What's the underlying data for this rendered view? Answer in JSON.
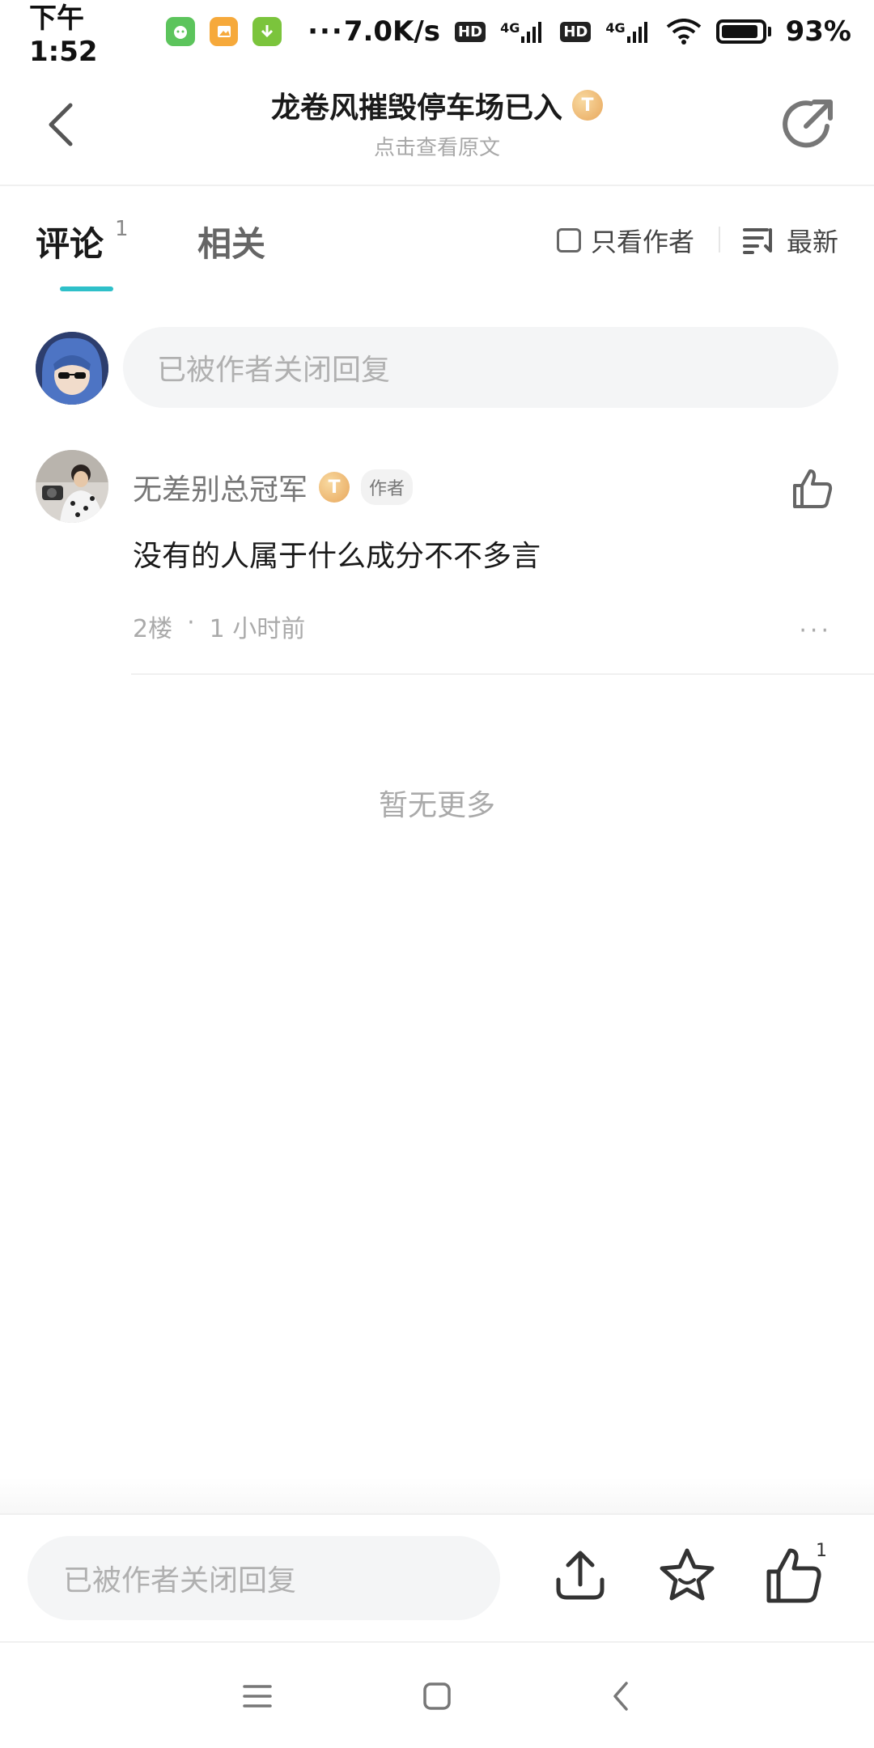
{
  "status_bar": {
    "time": "下午1:52",
    "more": "···",
    "speed": "7.0K/s",
    "hd1": "HD",
    "net1": "4G",
    "hd2": "HD",
    "net2": "4G",
    "battery": "93%",
    "battery_level": 0.93
  },
  "header": {
    "title": "龙卷风摧毁停车场已入",
    "level_badge": "T",
    "subtitle": "点击查看原文"
  },
  "tabs": {
    "comment_label": "评论",
    "comment_count": "1",
    "related_label": "相关",
    "author_only_label": "只看作者",
    "sort_label": "最新"
  },
  "reply_box": {
    "placeholder": "已被作者关闭回复"
  },
  "comment": {
    "username": "无差别总冠军",
    "level_badge": "T",
    "author_tag": "作者",
    "content": "没有的人属于什么成分不不多言",
    "floor": "2楼",
    "separator": "·",
    "time": "1 小时前",
    "more": "···"
  },
  "end_text": "暂无更多",
  "bottom_bar": {
    "placeholder": "已被作者关闭回复",
    "like_count": "1"
  },
  "colors": {
    "accent": "#2ec0c9",
    "badge": "#e8a75c"
  }
}
